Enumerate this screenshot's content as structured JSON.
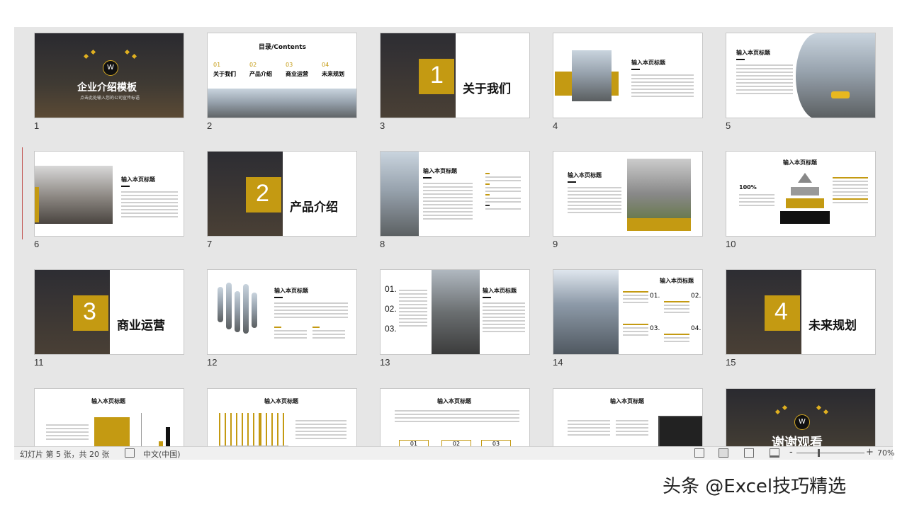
{
  "status": {
    "slide_info": "幻灯片 第 5 张，共 20 张",
    "language": "中文(中国)",
    "zoom": "70%",
    "zoom_minus": "-",
    "zoom_plus": "+"
  },
  "watermark": "头条 @Excel技巧精选",
  "slides": {
    "s1": {
      "num": "1",
      "title": "企业介绍模板",
      "subtitle": "点击此处输入您的公司宣传标语",
      "logo": "W"
    },
    "s2": {
      "num": "2",
      "title": "目录/Contents",
      "items": [
        {
          "idx": "01",
          "label": "关于我们"
        },
        {
          "idx": "02",
          "label": "产品介绍"
        },
        {
          "idx": "03",
          "label": "商业运营"
        },
        {
          "idx": "04",
          "label": "未来规划"
        }
      ]
    },
    "s3": {
      "num": "3",
      "big": "1",
      "title": "关于我们"
    },
    "s4": {
      "num": "4",
      "title": "输入本页标题"
    },
    "s5": {
      "num": "5",
      "title": "输入本页标题"
    },
    "s6": {
      "num": "6",
      "title": "输入本页标题"
    },
    "s7": {
      "num": "7",
      "big": "2",
      "title": "产品介绍"
    },
    "s8": {
      "num": "8",
      "title": "输入本页标题"
    },
    "s9": {
      "num": "9",
      "title": "输入本页标题"
    },
    "s10": {
      "num": "10",
      "title": "输入本页标题",
      "pct": "100%"
    },
    "s11": {
      "num": "11",
      "big": "3",
      "title": "商业运营"
    },
    "s12": {
      "num": "12",
      "title": "输入本页标题"
    },
    "s13": {
      "num": "13",
      "title": "输入本页标题",
      "steps": [
        "01.",
        "02.",
        "03."
      ]
    },
    "s14": {
      "num": "14",
      "title": "输入本页标题",
      "steps": [
        "01.",
        "02.",
        "03.",
        "04."
      ]
    },
    "s15": {
      "num": "15",
      "big": "4",
      "title": "未来规划"
    },
    "s16": {
      "title": "输入本页标题"
    },
    "s17": {
      "title": "输入本页标题"
    },
    "s18": {
      "title": "输入本页标题",
      "boxes": [
        "01",
        "02",
        "03"
      ]
    },
    "s19": {
      "title": "输入本页标题"
    },
    "s20": {
      "title": "谢谢观看",
      "logo": "W"
    }
  }
}
